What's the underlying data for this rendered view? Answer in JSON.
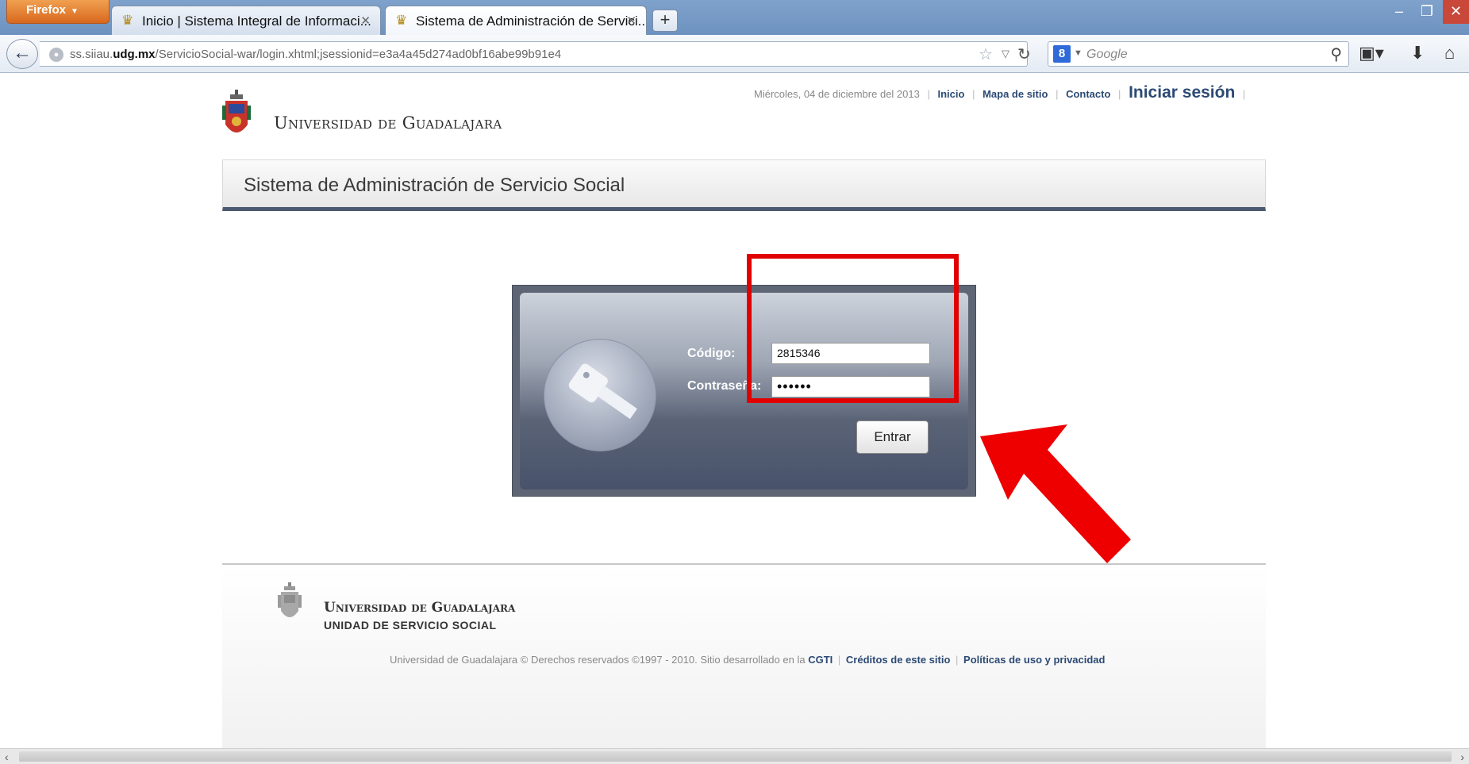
{
  "browser": {
    "menu_label": "Firefox",
    "tabs": [
      {
        "title": "Inicio | Sistema Integral de Informaci...",
        "active": false
      },
      {
        "title": "Sistema de Administración de Servici...",
        "active": true
      }
    ],
    "url_prefix": "ss.siiau.",
    "url_domain": "udg.mx",
    "url_path": "/ServicioSocial-war/login.xhtml;jsessionid=e3a4a45d274ad0bf16abe99b91e4",
    "search_engine": "8",
    "search_placeholder": "Google"
  },
  "header": {
    "logo_text": "Universidad de Guadalajara",
    "date": "Miércoles, 04 de diciembre del 2013",
    "links": {
      "inicio": "Inicio",
      "mapa": "Mapa de sitio",
      "contacto": "Contacto",
      "login": "Iniciar sesión"
    },
    "system_title": "Sistema de Administración de Servicio Social"
  },
  "login": {
    "code_label": "Código:",
    "password_label": "Contraseña:",
    "code_value": "2815346",
    "password_value": "••••••",
    "submit_label": "Entrar"
  },
  "footer": {
    "title": "Universidad de Guadalajara",
    "subtitle": "UNIDAD DE SERVICIO SOCIAL",
    "copyright": "Universidad de Guadalajara © Derechos reservados ©1997 - 2010. Sitio desarrollado en la",
    "cgti": "CGTI",
    "credits": "Créditos de este sitio",
    "policies": "Políticas de uso y privacidad"
  },
  "colors": {
    "annotation": "#e00000",
    "link": "#2c4a74",
    "chrome_blue": "#6e92bf"
  },
  "icons": [
    "firefox-menu-icon",
    "udg-crest-icon",
    "close-icon",
    "new-tab-icon",
    "back-icon",
    "globe-icon",
    "star-icon",
    "reload-icon",
    "google-icon",
    "search-icon",
    "bookmarks-icon",
    "download-icon",
    "home-icon",
    "key-icon",
    "arrow-annotation-icon"
  ]
}
